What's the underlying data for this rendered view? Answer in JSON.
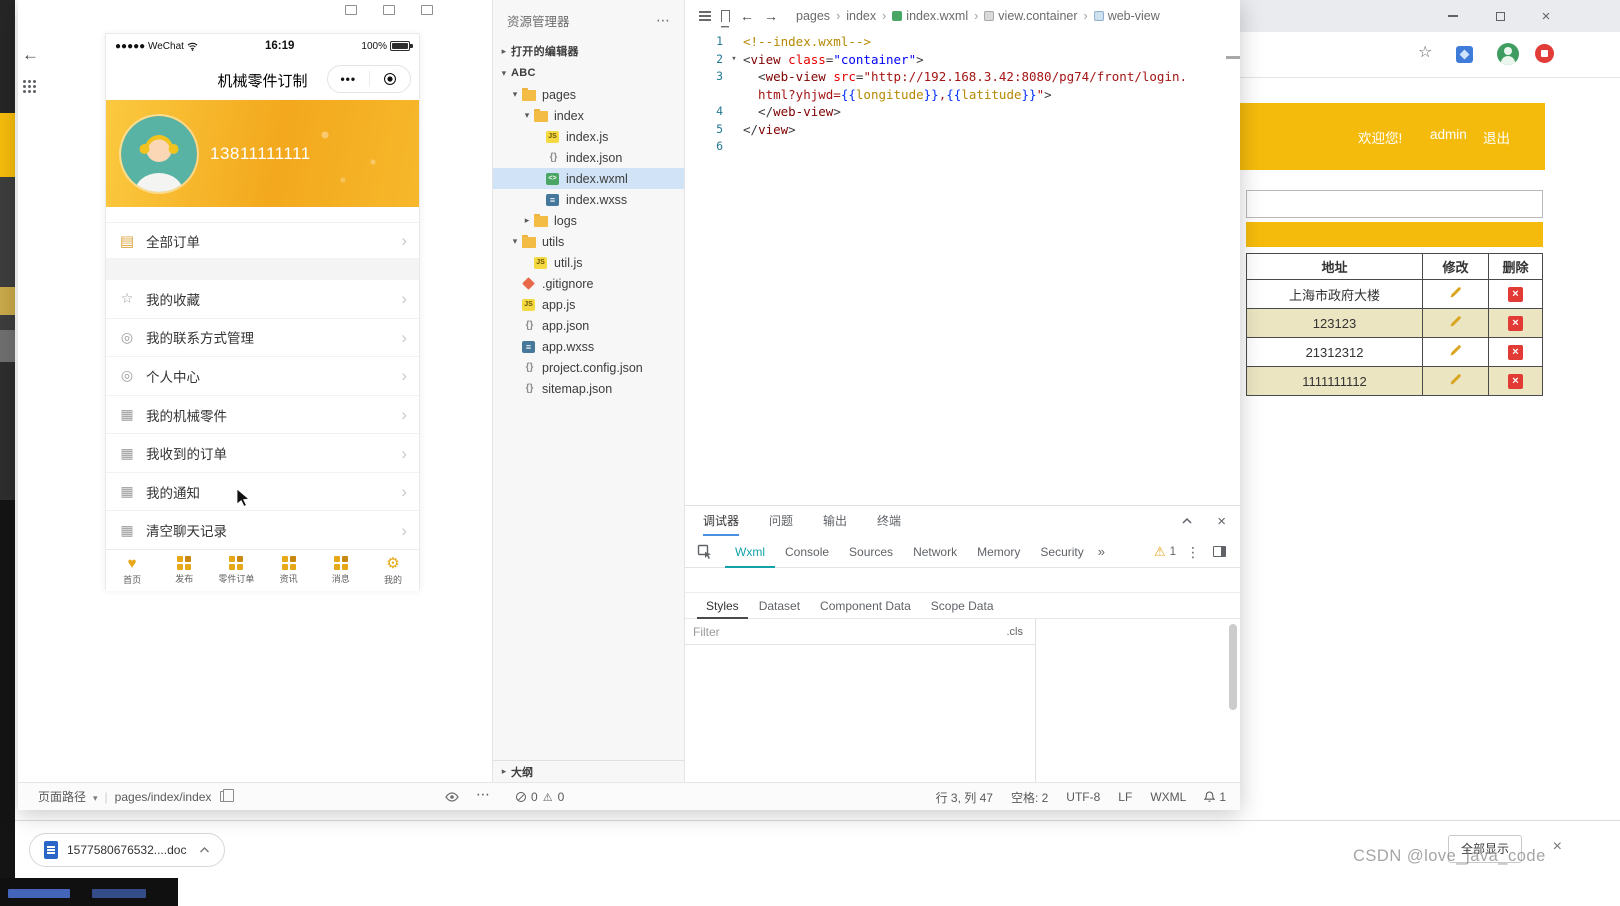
{
  "devtools": {
    "simulator": {
      "status": {
        "carrier": "●●●●● WeChat",
        "time": "16:19",
        "battery": "100%"
      },
      "navbar": {
        "title": "机械零件订制",
        "capsule_dots": "•••"
      },
      "profile": {
        "phone": "13811111111"
      },
      "order_entry": {
        "label": "全部订单",
        "icon": "orders-icon"
      },
      "menu": [
        {
          "label": "我的收藏",
          "icon": "star-icon"
        },
        {
          "label": "我的联系方式管理",
          "icon": "contact-icon"
        },
        {
          "label": "个人中心",
          "icon": "profile-icon"
        },
        {
          "label": "我的机械零件",
          "icon": "parts-icon"
        },
        {
          "label": "我收到的订单",
          "icon": "received-orders-icon"
        },
        {
          "label": "我的通知",
          "icon": "notice-icon"
        },
        {
          "label": "清空聊天记录",
          "icon": "clear-chat-icon"
        }
      ],
      "tabbar": [
        {
          "label": "首页",
          "icon": "home"
        },
        {
          "label": "发布",
          "icon": "publish"
        },
        {
          "label": "零件订单",
          "icon": "orders"
        },
        {
          "label": "资讯",
          "icon": "news"
        },
        {
          "label": "消息",
          "icon": "messages"
        },
        {
          "label": "我的",
          "icon": "me"
        }
      ]
    },
    "explorer": {
      "title": "资源管理器",
      "open_editors": "打开的编辑器",
      "project": "ABC",
      "outline": "大纲",
      "tree": [
        {
          "label": "pages",
          "type": "folder",
          "level": 1,
          "expanded": true
        },
        {
          "label": "index",
          "type": "folder",
          "level": 2,
          "expanded": true
        },
        {
          "label": "index.js",
          "type": "js",
          "level": 3
        },
        {
          "label": "index.json",
          "type": "json",
          "level": 3
        },
        {
          "label": "index.wxml",
          "type": "wxml",
          "level": 3,
          "selected": true
        },
        {
          "label": "index.wxss",
          "type": "wxss",
          "level": 3
        },
        {
          "label": "logs",
          "type": "folder",
          "level": 2,
          "expanded": false
        },
        {
          "label": "utils",
          "type": "folder",
          "level": 1,
          "expanded": true
        },
        {
          "label": "util.js",
          "type": "js",
          "level": 2
        },
        {
          "label": ".gitignore",
          "type": "git",
          "level": 1
        },
        {
          "label": "app.js",
          "type": "js",
          "level": 1
        },
        {
          "label": "app.json",
          "type": "json",
          "level": 1
        },
        {
          "label": "app.wxss",
          "type": "wxss",
          "level": 1
        },
        {
          "label": "project.config.json",
          "type": "json",
          "level": 1
        },
        {
          "label": "sitemap.json",
          "type": "json",
          "level": 1
        }
      ]
    },
    "editor": {
      "breadcrumb": [
        {
          "label": "pages"
        },
        {
          "label": "index"
        },
        {
          "label": "index.wxml",
          "icon": "wxml-file-icon"
        },
        {
          "label": "view.container",
          "icon": "container-icon"
        },
        {
          "label": "web-view",
          "icon": "tag-icon"
        }
      ],
      "code_lines": [
        {
          "num": "1",
          "tokens": [
            [
              "comment",
              "<!--index.wxml-->"
            ]
          ]
        },
        {
          "num": "2",
          "fold": true,
          "tokens": [
            [
              "punct",
              "<"
            ],
            [
              "tag",
              "view"
            ],
            [
              "attr",
              " class"
            ],
            [
              "punct",
              "="
            ],
            [
              "val",
              "\"container\""
            ],
            [
              "punct",
              ">"
            ]
          ]
        },
        {
          "num": "3",
          "tokens": [
            [
              "punct",
              "  <"
            ],
            [
              "tag",
              "web-view"
            ],
            [
              "attr",
              " src"
            ],
            [
              "punct",
              "="
            ],
            [
              "str",
              "\"http://192.168.3.42:8080/pg74/front/login."
            ]
          ]
        },
        {
          "num": "",
          "tokens": [
            [
              "str",
              "  html?yhjwd="
            ],
            [
              "brace",
              "{{"
            ],
            [
              "mvar",
              "longitude"
            ],
            [
              "brace",
              "}}"
            ],
            [
              "str",
              ","
            ],
            [
              "brace",
              "{{"
            ],
            [
              "mvar",
              "latitude"
            ],
            [
              "brace",
              "}}"
            ],
            [
              "str",
              "\""
            ],
            [
              "punct",
              ">"
            ]
          ]
        },
        {
          "num": "4",
          "tokens": [
            [
              "punct",
              "  </"
            ],
            [
              "tag",
              "web-view"
            ],
            [
              "punct",
              ">"
            ]
          ]
        },
        {
          "num": "5",
          "tokens": [
            [
              "punct",
              "</"
            ],
            [
              "tag",
              "view"
            ],
            [
              "punct",
              ">"
            ]
          ]
        },
        {
          "num": "6",
          "tokens": []
        }
      ]
    },
    "debugger": {
      "panel_tabs": [
        {
          "label": "调试器",
          "active": true
        },
        {
          "label": "问题"
        },
        {
          "label": "输出"
        },
        {
          "label": "终端"
        }
      ],
      "devtool_tabs": [
        {
          "label": "Wxml",
          "active": true
        },
        {
          "label": "Console"
        },
        {
          "label": "Sources"
        },
        {
          "label": "Network"
        },
        {
          "label": "Memory"
        },
        {
          "label": "Security"
        }
      ],
      "overflow": "»",
      "warning_count": "1",
      "inspector_subtabs": [
        {
          "label": "Styles",
          "active": true
        },
        {
          "label": "Dataset"
        },
        {
          "label": "Component Data"
        },
        {
          "label": "Scope Data"
        }
      ],
      "filter_placeholder": "Filter",
      "cls_label": ".cls"
    },
    "statusbar": {
      "page_path_label": "页面路径",
      "page_path": "pages/index/index",
      "error_count": "0",
      "warn_count": "0",
      "cursor_pos": "行 3, 列 47",
      "indent": "空格: 2",
      "encoding": "UTF-8",
      "eol": "LF",
      "language": "WXML",
      "bell_count": "1"
    }
  },
  "browser": {
    "page": {
      "welcome": "欢迎您!",
      "username": "admin",
      "logout": "退出",
      "table": {
        "headers": [
          "地址",
          "修改",
          "删除"
        ],
        "rows": [
          {
            "address": "上海市政府大楼",
            "zebra": false
          },
          {
            "address": "123123",
            "zebra": true
          },
          {
            "address": "21312312",
            "zebra": false
          },
          {
            "address": "1111111112",
            "zebra": true
          }
        ]
      }
    }
  },
  "downloads_bar": {
    "filename": "1577580676532....doc",
    "show_all": "全部显示"
  },
  "watermark": "CSDN @love_java_code",
  "colors": {
    "accent_gold": "#f5bb0c",
    "tab_active_teal": "#12a2aa",
    "selected_row_blue": "#d1e3f6",
    "danger_red": "#e23b36"
  }
}
